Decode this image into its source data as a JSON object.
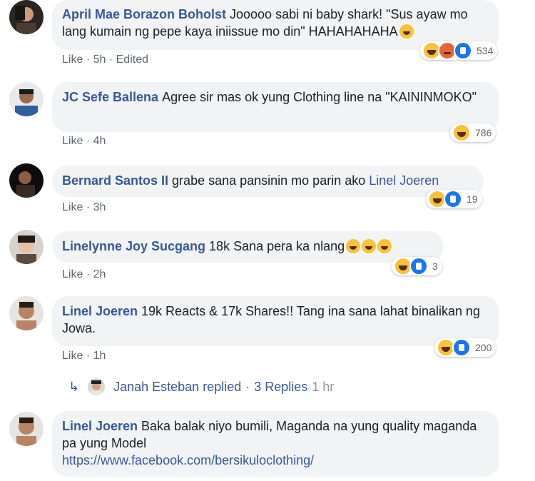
{
  "comments": [
    {
      "author": "April Mae Borazon Boholst",
      "text": "Jooooo sabi ni baby shark! \"Sus ayaw mo lang kumain ng pepe kaya iniissue mo din\" HAHAHAHAHA",
      "like_label": "Like",
      "time": "5h",
      "edited": "Edited",
      "reaction_count": "534",
      "reaction_icons": [
        "haha-icon",
        "angry-icon",
        "like-icon"
      ]
    },
    {
      "author": "JC Sefe Ballena",
      "text": "Agree sir mas ok yung Clothing line na \"KAININMOKO\"",
      "like_label": "Like",
      "time": "4h",
      "reaction_count": "786",
      "reaction_icons": [
        "haha-icon"
      ]
    },
    {
      "author": "Bernard Santos II",
      "text": "grabe sana pansinin mo parin ako",
      "mention": "Linel Joeren",
      "like_label": "Like",
      "time": "3h",
      "reaction_count": "19",
      "reaction_icons": [
        "haha-icon",
        "like-icon"
      ]
    },
    {
      "author": "Linelynne Joy Sucgang",
      "text": "18k Sana pera ka nlang",
      "like_label": "Like",
      "time": "2h",
      "reaction_count": "3",
      "reaction_icons": [
        "haha-icon",
        "like-icon"
      ]
    },
    {
      "author": "Linel Joeren",
      "text": "19k Reacts & 17k Shares!! Tang ina sana lahat binalikan ng Jowa.",
      "like_label": "Like",
      "time": "1h",
      "reaction_count": "200",
      "reaction_icons": [
        "haha-icon",
        "like-icon"
      ]
    },
    {
      "author": "Linel Joeren",
      "text": "Baka balak niyo bumili, Maganda na yung quality maganda pa yung Model",
      "link": "https://www.facebook.com/bersikuloclothing/"
    }
  ],
  "replies": {
    "name": "Janah Esteban replied",
    "separator": "·",
    "count": "3 Replies",
    "time": "1 hr"
  },
  "separator": "·",
  "colors": {
    "link": "#385898",
    "bubble": "#f2f3f5",
    "meta": "#606770"
  }
}
